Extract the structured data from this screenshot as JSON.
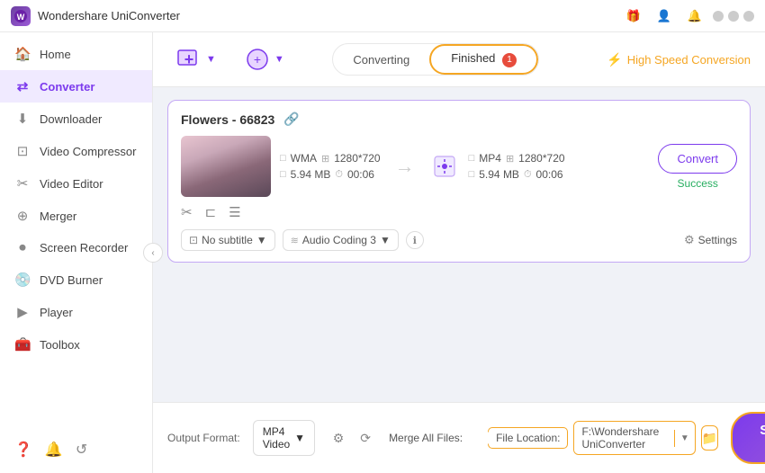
{
  "titlebar": {
    "app_name": "Wondershare UniConverter",
    "logo_text": "W"
  },
  "sidebar": {
    "items": [
      {
        "id": "home",
        "label": "Home",
        "icon": "🏠"
      },
      {
        "id": "converter",
        "label": "Converter",
        "icon": "⇄",
        "active": true
      },
      {
        "id": "downloader",
        "label": "Downloader",
        "icon": "⬇"
      },
      {
        "id": "video-compressor",
        "label": "Video Compressor",
        "icon": "⊡"
      },
      {
        "id": "video-editor",
        "label": "Video Editor",
        "icon": "✂"
      },
      {
        "id": "merger",
        "label": "Merger",
        "icon": "⊕"
      },
      {
        "id": "screen-recorder",
        "label": "Screen Recorder",
        "icon": "⏺"
      },
      {
        "id": "dvd-burner",
        "label": "DVD Burner",
        "icon": "💿"
      },
      {
        "id": "player",
        "label": "Player",
        "icon": "▶"
      },
      {
        "id": "toolbox",
        "label": "Toolbox",
        "icon": "🧰"
      }
    ],
    "bottom_icons": [
      "?",
      "🔔",
      "↺"
    ]
  },
  "toolbar": {
    "add_files_label": "+",
    "add_files_tooltip": "Add Files",
    "tabs": [
      {
        "id": "converting",
        "label": "Converting",
        "active": false,
        "badge": null
      },
      {
        "id": "finished",
        "label": "Finished",
        "active": true,
        "badge": "1"
      }
    ],
    "high_speed_label": "High Speed Conversion"
  },
  "file_card": {
    "name": "Flowers - 66823",
    "source": {
      "format": "WMA",
      "resolution": "1280*720",
      "size": "5.94 MB",
      "duration": "00:06"
    },
    "target": {
      "format": "MP4",
      "resolution": "1280*720",
      "size": "5.94 MB",
      "duration": "00:06"
    },
    "convert_btn_label": "Convert",
    "status": "Success",
    "subtitle_label": "No subtitle",
    "audio_label": "Audio Coding 3",
    "settings_label": "Settings"
  },
  "bottom_bar": {
    "output_format_label": "Output Format:",
    "output_format_value": "MP4 Video",
    "merge_label": "Merge All Files:",
    "file_location_label": "File Location:",
    "file_location_path": "F:\\Wondershare UniConverter",
    "start_all_label": "Start All"
  }
}
